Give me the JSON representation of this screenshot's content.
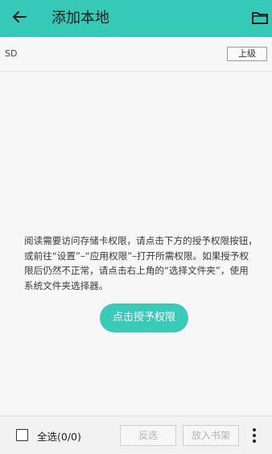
{
  "header": {
    "title": "添加本地",
    "back_icon": "back-arrow-icon",
    "folder_icon": "folder-icon"
  },
  "pathbar": {
    "path": "SD",
    "up_label": "上级"
  },
  "message": "阅读需要访问存储卡权限，请点击下方的授予权限按钮，或前往“设置”–“应用权限”–打开所需权限。如果授予权限后仍然不正常，请点击右上角的“选择文件夹”，使用系统文件夹选择器。",
  "grant_button": "点击授予权限",
  "bottom": {
    "select_all": "全选(0/0)",
    "invert": "反选",
    "add_to_shelf": "放入书架",
    "more_icon": "more-vertical-icon"
  },
  "colors": {
    "accent": "#36c9b8"
  }
}
